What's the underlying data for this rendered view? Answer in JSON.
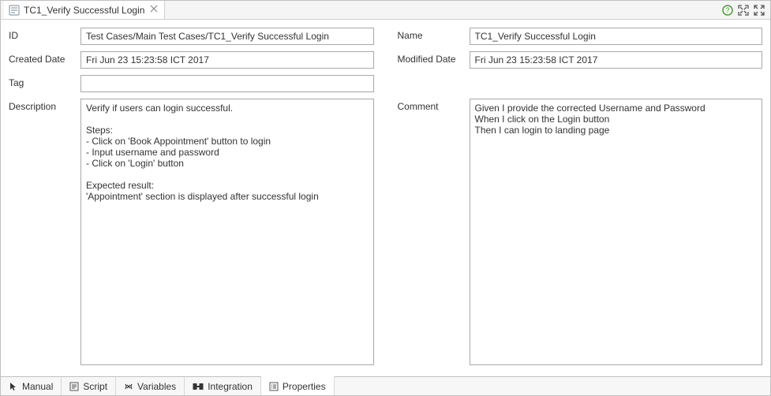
{
  "titlebar": {
    "tab_title": "TC1_Verify Successful Login"
  },
  "left": {
    "id_label": "ID",
    "id_value": "Test Cases/Main Test Cases/TC1_Verify Successful Login",
    "created_label": "Created Date",
    "created_value": "Fri Jun 23 15:23:58 ICT 2017",
    "tag_label": "Tag",
    "tag_value": "",
    "description_label": "Description",
    "description_value": "Verify if users can login successful.\n\nSteps:\n- Click on 'Book Appointment' button to login\n- Input username and password\n- Click on 'Login' button\n\nExpected result:\n'Appointment' section is displayed after successful login"
  },
  "right": {
    "name_label": "Name",
    "name_value": "TC1_Verify Successful Login",
    "modified_label": "Modified Date",
    "modified_value": "Fri Jun 23 15:23:58 ICT 2017",
    "comment_label": "Comment",
    "comment_value": "Given I provide the corrected Username and Password\nWhen I click on the Login button\nThen I can login to landing page"
  },
  "bottom_tabs": {
    "manual": "Manual",
    "script": "Script",
    "variables": "Variables",
    "integration": "Integration",
    "properties": "Properties"
  }
}
